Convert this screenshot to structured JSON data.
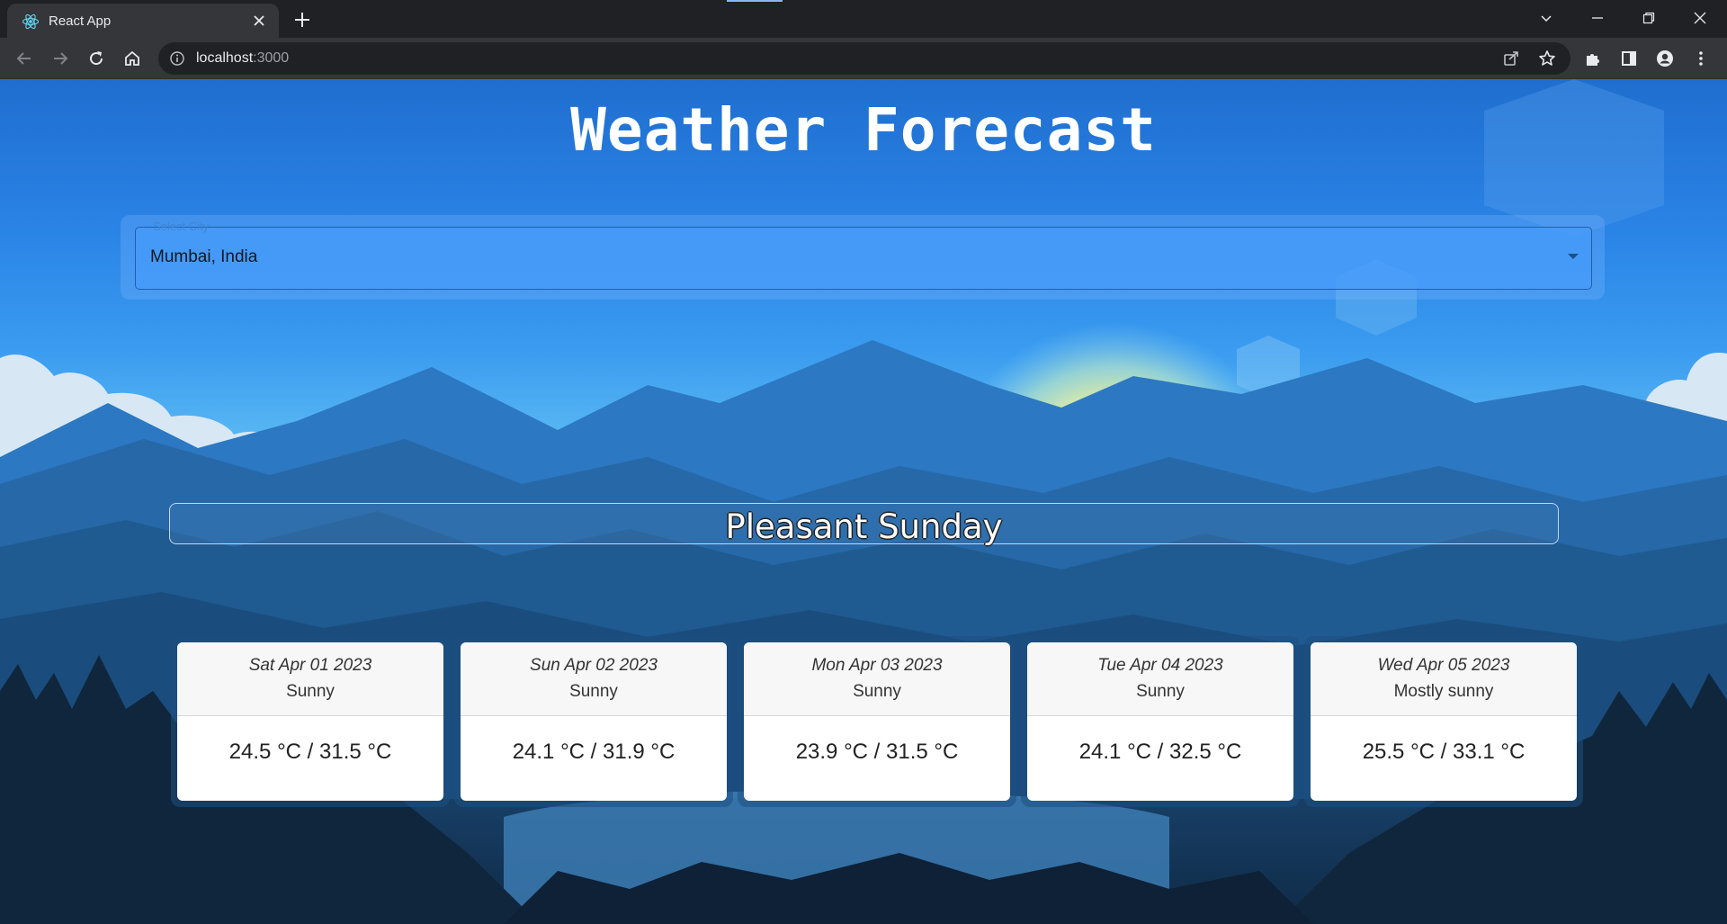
{
  "browser": {
    "tab_title": "React App",
    "url_host": "localhost",
    "url_port": ":3000"
  },
  "icons": {
    "tab_favicon": "react-logo-icon",
    "close": "close-icon",
    "new_tab": "plus-icon",
    "back": "arrow-left-icon",
    "forward": "arrow-right-icon",
    "reload": "reload-icon",
    "home": "home-icon",
    "site_info": "info-icon",
    "share": "share-icon",
    "bookmark": "star-icon",
    "extensions": "puzzle-icon",
    "side_panel": "side-panel-icon",
    "profile": "profile-icon",
    "menu": "kebab-menu-icon",
    "dropdown": "caret-down-icon"
  },
  "app": {
    "title": "Weather Forecast",
    "select": {
      "label": "Select City",
      "value": "Mumbai, India"
    },
    "banner": "Pleasant Sunday",
    "forecast": [
      {
        "date": "Sat Apr 01 2023",
        "condition": "Sunny",
        "temp": "24.5 °C / 31.5 °C"
      },
      {
        "date": "Sun Apr 02 2023",
        "condition": "Sunny",
        "temp": "24.1 °C / 31.9 °C"
      },
      {
        "date": "Mon Apr 03 2023",
        "condition": "Sunny",
        "temp": "23.9 °C / 31.5 °C"
      },
      {
        "date": "Tue Apr 04 2023",
        "condition": "Sunny",
        "temp": "24.1 °C / 32.5 °C"
      },
      {
        "date": "Wed Apr 05 2023",
        "condition": "Mostly sunny",
        "temp": "25.5 °C / 33.1 °C"
      }
    ]
  },
  "colors": {
    "chrome_dark": "#202124",
    "chrome_toolbar": "#35363a",
    "sky_top": "#1f6ecf",
    "sun": "#f3ee9a",
    "card_bg": "#ffffff"
  }
}
